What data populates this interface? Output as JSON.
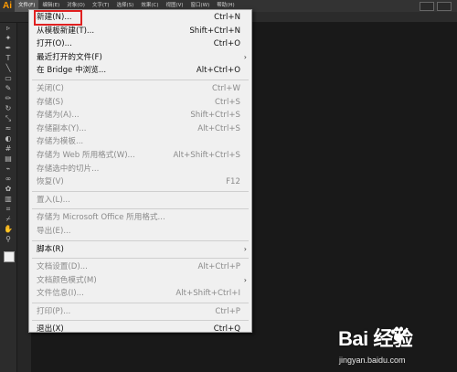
{
  "app": {
    "logo": "Ai"
  },
  "menubar": {
    "items": [
      "文件(F)",
      "编辑(E)",
      "对象(O)",
      "文字(T)",
      "选择(S)",
      "效果(C)",
      "视图(V)",
      "窗口(W)",
      "帮助(H)"
    ]
  },
  "file_menu": {
    "groups": [
      [
        {
          "label": "新建(N)...",
          "shortcut": "Ctrl+N",
          "enabled": true,
          "highlighted": true
        },
        {
          "label": "从模板新建(T)...",
          "shortcut": "Shift+Ctrl+N",
          "enabled": true
        },
        {
          "label": "打开(O)...",
          "shortcut": "Ctrl+O",
          "enabled": true
        },
        {
          "label": "最近打开的文件(F)",
          "shortcut": "",
          "enabled": true,
          "submenu": true
        },
        {
          "label": "在 Bridge 中浏览...",
          "shortcut": "Alt+Ctrl+O",
          "enabled": true
        }
      ],
      [
        {
          "label": "关闭(C)",
          "shortcut": "Ctrl+W",
          "enabled": false
        },
        {
          "label": "存储(S)",
          "shortcut": "Ctrl+S",
          "enabled": false
        },
        {
          "label": "存储为(A)...",
          "shortcut": "Shift+Ctrl+S",
          "enabled": false
        },
        {
          "label": "存储副本(Y)...",
          "shortcut": "Alt+Ctrl+S",
          "enabled": false
        },
        {
          "label": "存储为模板...",
          "shortcut": "",
          "enabled": false
        },
        {
          "label": "存储为 Web 所用格式(W)...",
          "shortcut": "Alt+Shift+Ctrl+S",
          "enabled": false
        },
        {
          "label": "存储选中的切片...",
          "shortcut": "",
          "enabled": false
        },
        {
          "label": "恢复(V)",
          "shortcut": "F12",
          "enabled": false
        }
      ],
      [
        {
          "label": "置入(L)...",
          "shortcut": "",
          "enabled": false
        }
      ],
      [
        {
          "label": "存储为 Microsoft Office 所用格式...",
          "shortcut": "",
          "enabled": false
        },
        {
          "label": "导出(E)...",
          "shortcut": "",
          "enabled": false
        }
      ],
      [
        {
          "label": "脚本(R)",
          "shortcut": "",
          "enabled": true,
          "submenu": true
        }
      ],
      [
        {
          "label": "文档设置(D)...",
          "shortcut": "Alt+Ctrl+P",
          "enabled": false
        },
        {
          "label": "文档颜色模式(M)",
          "shortcut": "",
          "enabled": false,
          "submenu": true
        },
        {
          "label": "文件信息(I)...",
          "shortcut": "Alt+Shift+Ctrl+I",
          "enabled": false
        }
      ],
      [
        {
          "label": "打印(P)...",
          "shortcut": "Ctrl+P",
          "enabled": false
        }
      ],
      [
        {
          "label": "退出(X)",
          "shortcut": "Ctrl+Q",
          "enabled": true
        }
      ]
    ]
  },
  "watermark": {
    "brand": "Bai 经验",
    "url": "jingyan.baidu.com"
  },
  "colors": {
    "highlight_box": "#e02020",
    "ai_logo": "#ff9a00",
    "menu_bg": "#f0f0f0"
  }
}
